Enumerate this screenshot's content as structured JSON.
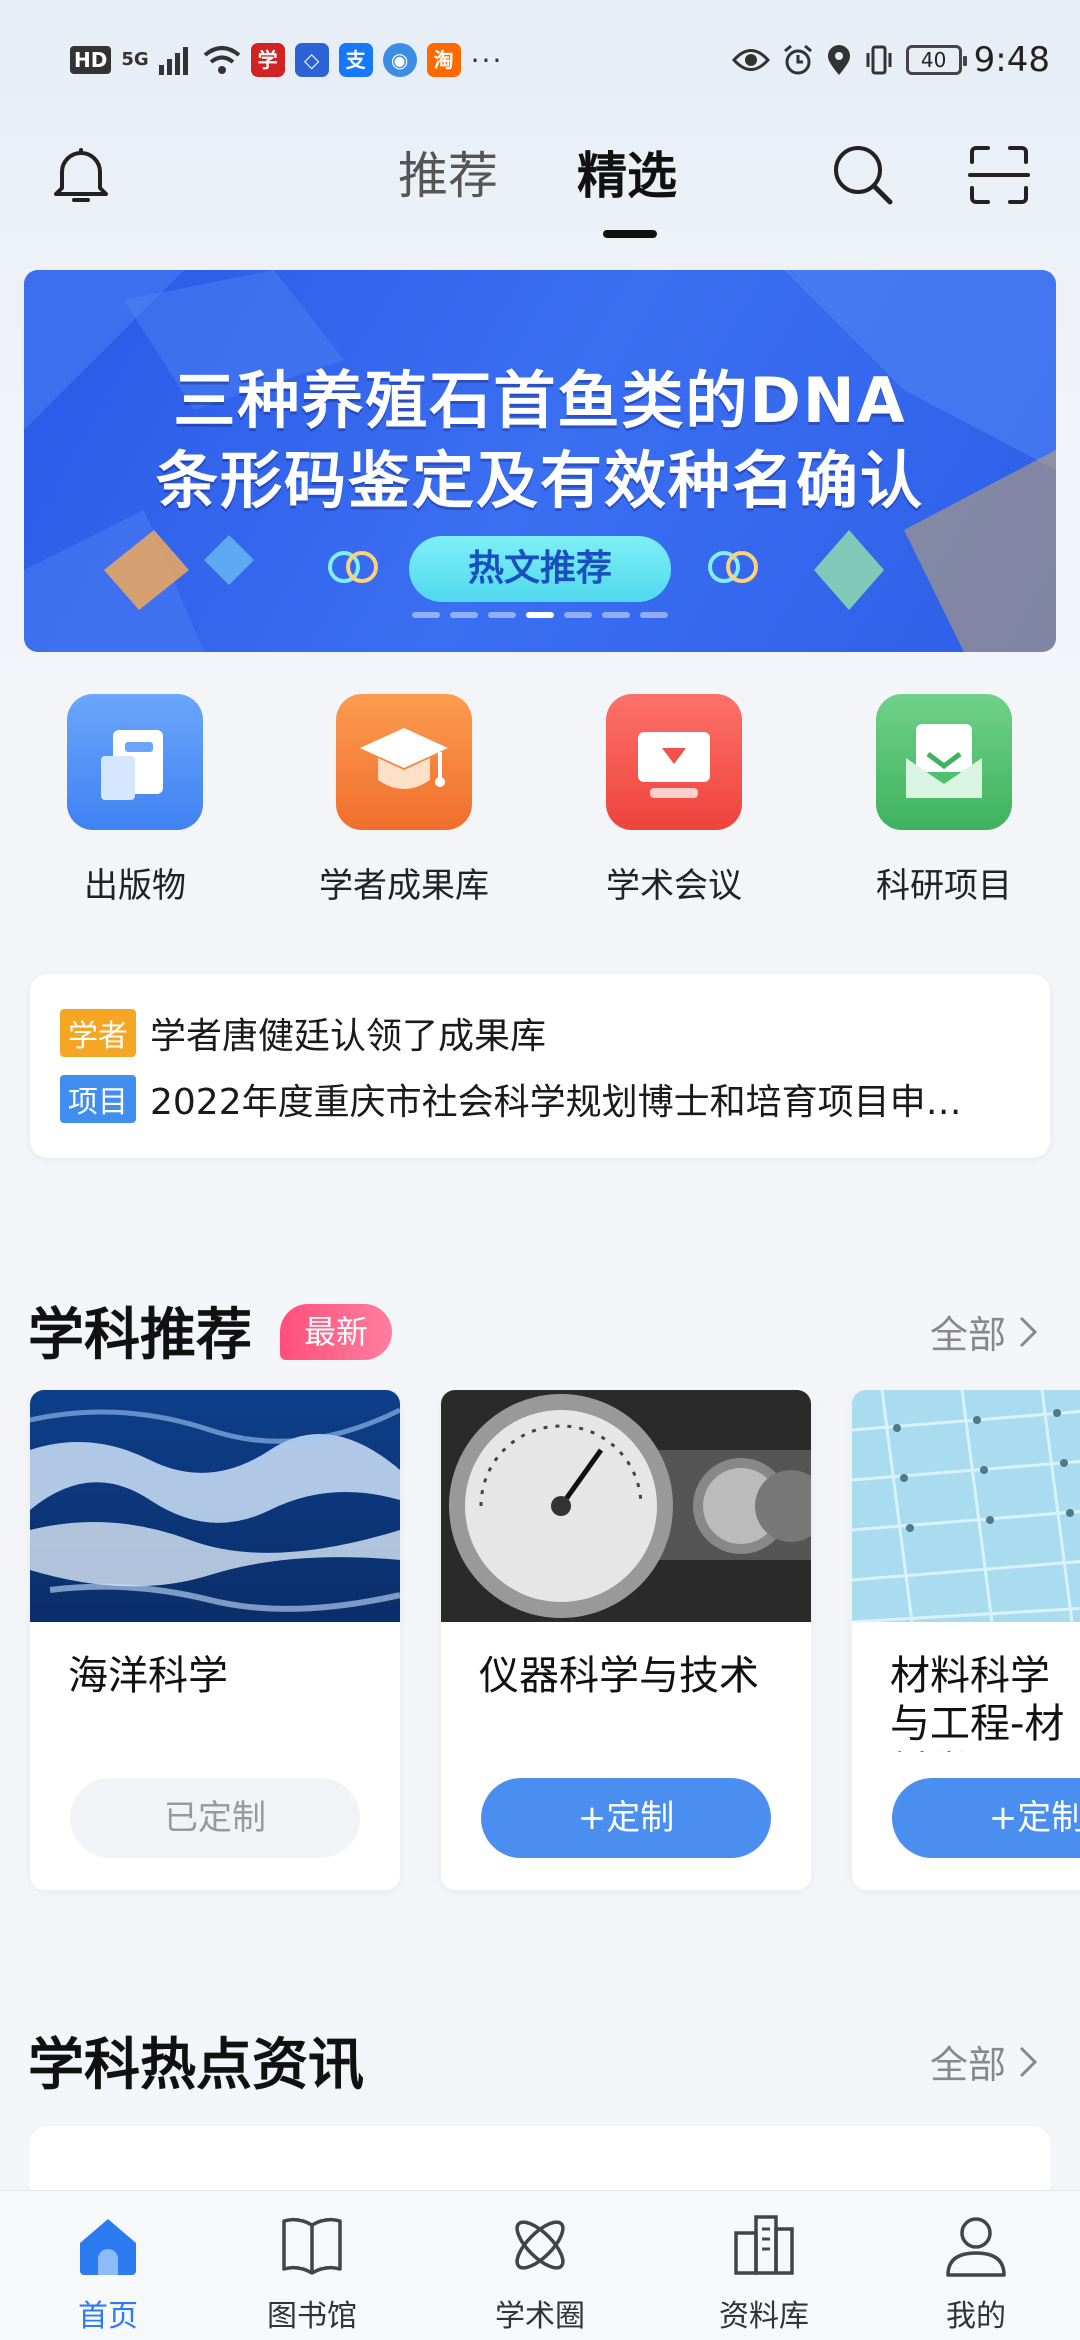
{
  "status_bar": {
    "hd": "HD",
    "network": "5G",
    "more": "···",
    "battery": "40",
    "time": "9:48"
  },
  "header": {
    "tabs": [
      {
        "label": "推荐",
        "active": false
      },
      {
        "label": "精选",
        "active": true
      }
    ]
  },
  "banner": {
    "title_line1": "三种养殖石首鱼类的DNA",
    "title_line2": "条形码鉴定及有效种名确认",
    "pill": "热文推荐",
    "dot_count": 7,
    "active_dot": 3
  },
  "quick_entries": [
    {
      "label": "出版物",
      "icon": "publication-icon",
      "color": "#4b8ff5"
    },
    {
      "label": "学者成果库",
      "icon": "graduation-cap-icon",
      "color": "#f7813a"
    },
    {
      "label": "学术会议",
      "icon": "conference-icon",
      "color": "#f2504b"
    },
    {
      "label": "科研项目",
      "icon": "project-icon",
      "color": "#4fc06b"
    }
  ],
  "ticker": [
    {
      "tag": "学者",
      "tag_color": "#f5a623",
      "text": "学者唐健廷认领了成果库"
    },
    {
      "tag": "项目",
      "tag_color": "#3f8ef0",
      "text": "2022年度重庆市社会科学规划博士和培育项目申…"
    }
  ],
  "subject_section": {
    "title": "学科推荐",
    "badge": "最新",
    "more": "全部"
  },
  "subject_cards": [
    {
      "title": "海洋科学",
      "button": "已定制",
      "subscribed": true
    },
    {
      "title": "仪器科学与技术",
      "button": "+定制",
      "subscribed": false
    },
    {
      "title": "材料科学与工程-材料学",
      "title_visible": "材料科学\n程-材料学",
      "button": "+定制",
      "subscribed": false
    }
  ],
  "hot_section": {
    "title": "学科热点资讯",
    "more": "全部"
  },
  "bottom_nav": [
    {
      "label": "首页",
      "icon": "home-icon",
      "active": true
    },
    {
      "label": "图书馆",
      "icon": "book-icon",
      "active": false
    },
    {
      "label": "学术圈",
      "icon": "atom-icon",
      "active": false
    },
    {
      "label": "资料库",
      "icon": "database-icon",
      "active": false
    },
    {
      "label": "我的",
      "icon": "profile-icon",
      "active": false
    }
  ],
  "colors": {
    "accent": "#2d7bf0",
    "banner_blue": "#2e5fe8",
    "badge_pink": "#ff4f7a"
  }
}
